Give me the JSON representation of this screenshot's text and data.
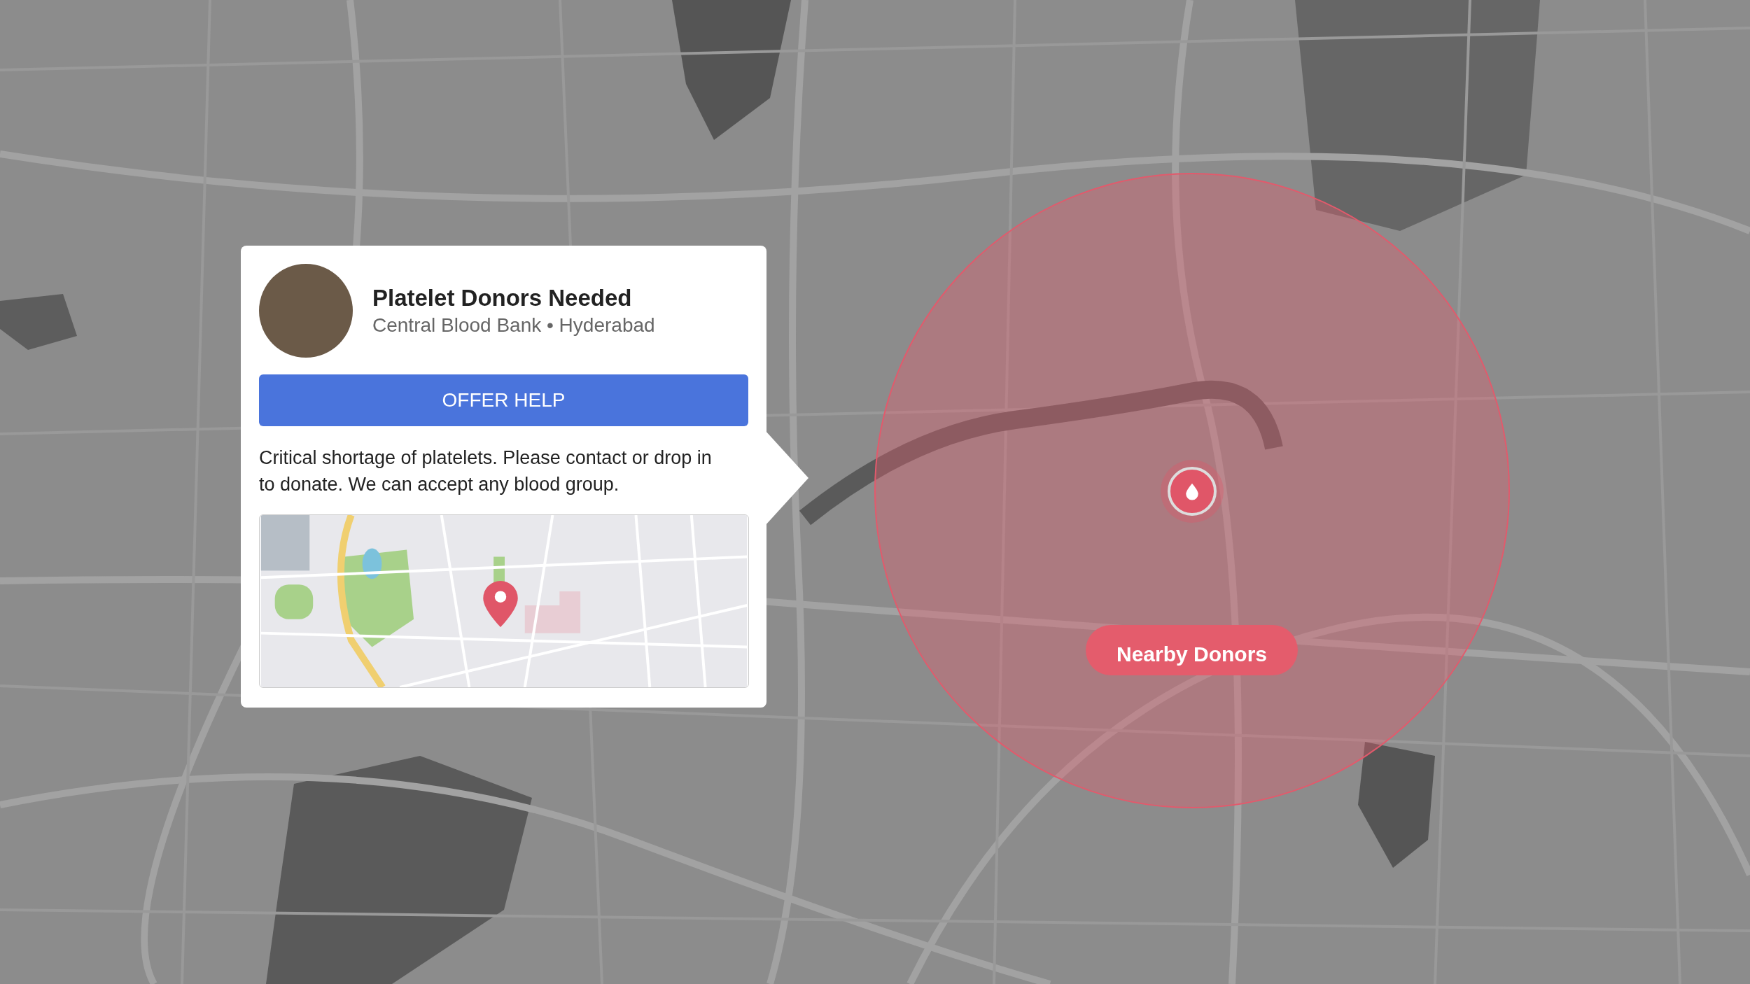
{
  "request_card": {
    "title": "Platelet Donors Needed",
    "subtitle": "Central Blood Bank • Hyderabad",
    "action": "OFFER HELP",
    "description": "Critical shortage of platelets. Please contact or drop in to donate. We can accept any blood group."
  },
  "map": {
    "nearby_button": "Nearby Donors"
  }
}
